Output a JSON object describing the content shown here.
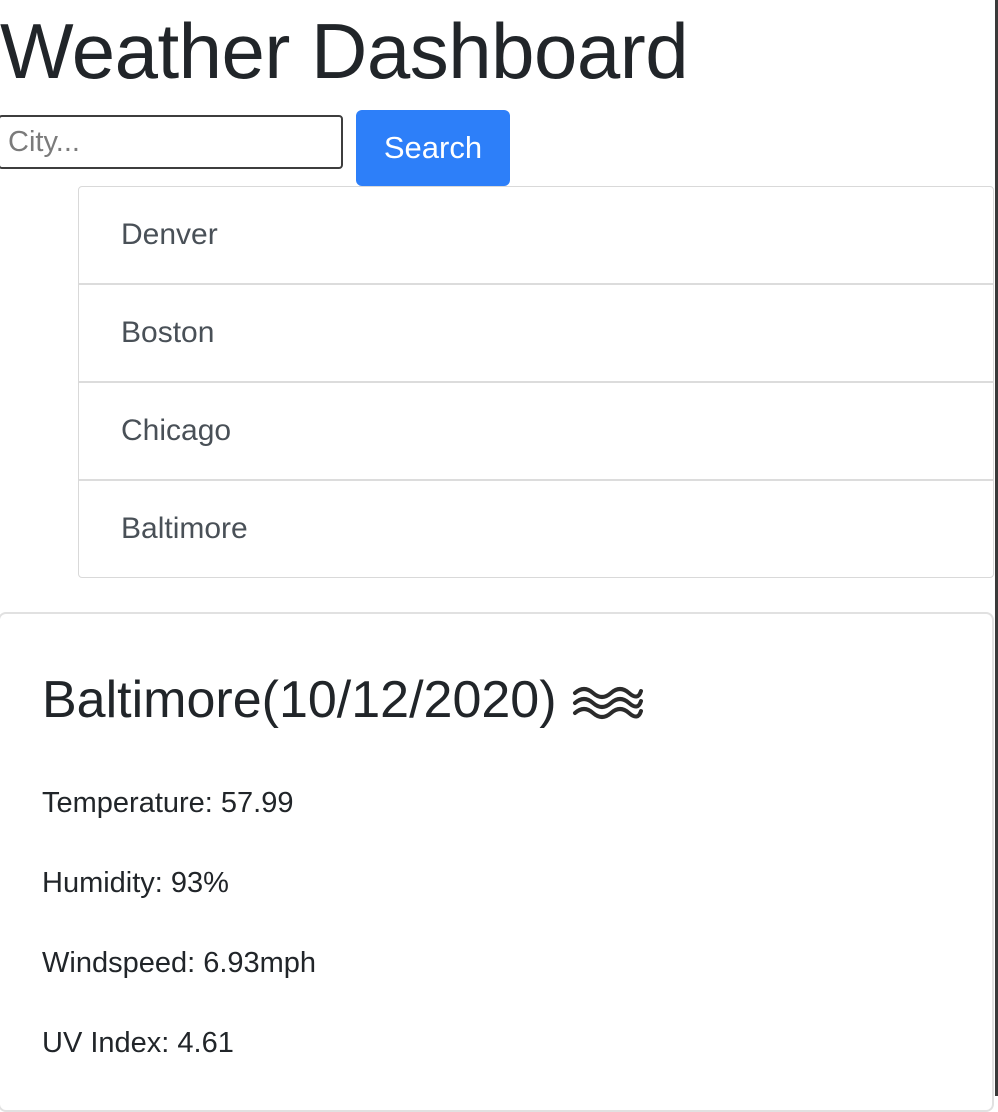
{
  "header": {
    "title": "Weather Dashboard"
  },
  "search": {
    "placeholder": "City...",
    "value": "",
    "button_label": "Search"
  },
  "history": {
    "cities": [
      "Denver",
      "Boston",
      "Chicago",
      "Baltimore"
    ]
  },
  "current": {
    "heading": "Baltimore(10/12/2020)",
    "icon": "mist-icon",
    "temperature": "Temperature: 57.99",
    "humidity": "Humidity: 93%",
    "windspeed": "Windspeed: 6.93mph",
    "uv_index": "UV Index: 4.61"
  },
  "colors": {
    "primary_button": "#2d7ff9",
    "text": "#212529",
    "muted_text": "#495057",
    "border": "#dcdcdc"
  }
}
